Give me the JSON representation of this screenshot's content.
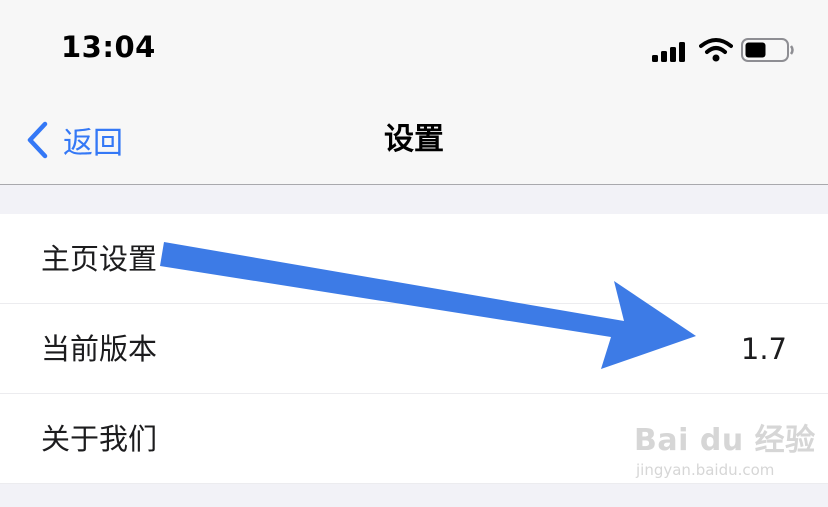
{
  "status_bar": {
    "time": "13:04"
  },
  "nav": {
    "back_label": "返回",
    "title": "设置"
  },
  "settings": {
    "items": [
      {
        "label": "主页设置",
        "value": ""
      },
      {
        "label": "当前版本",
        "value": "1.7"
      },
      {
        "label": "关于我们",
        "value": ""
      }
    ]
  },
  "watermark": {
    "main": "Bai du 经验",
    "sub": "jingyan.baidu.com"
  },
  "colors": {
    "accent": "#3478f6",
    "annotation_arrow": "#3d7be6"
  },
  "icons": [
    "signal-icon",
    "wifi-icon",
    "battery-icon",
    "chevron-left-icon",
    "annotation-arrow"
  ]
}
